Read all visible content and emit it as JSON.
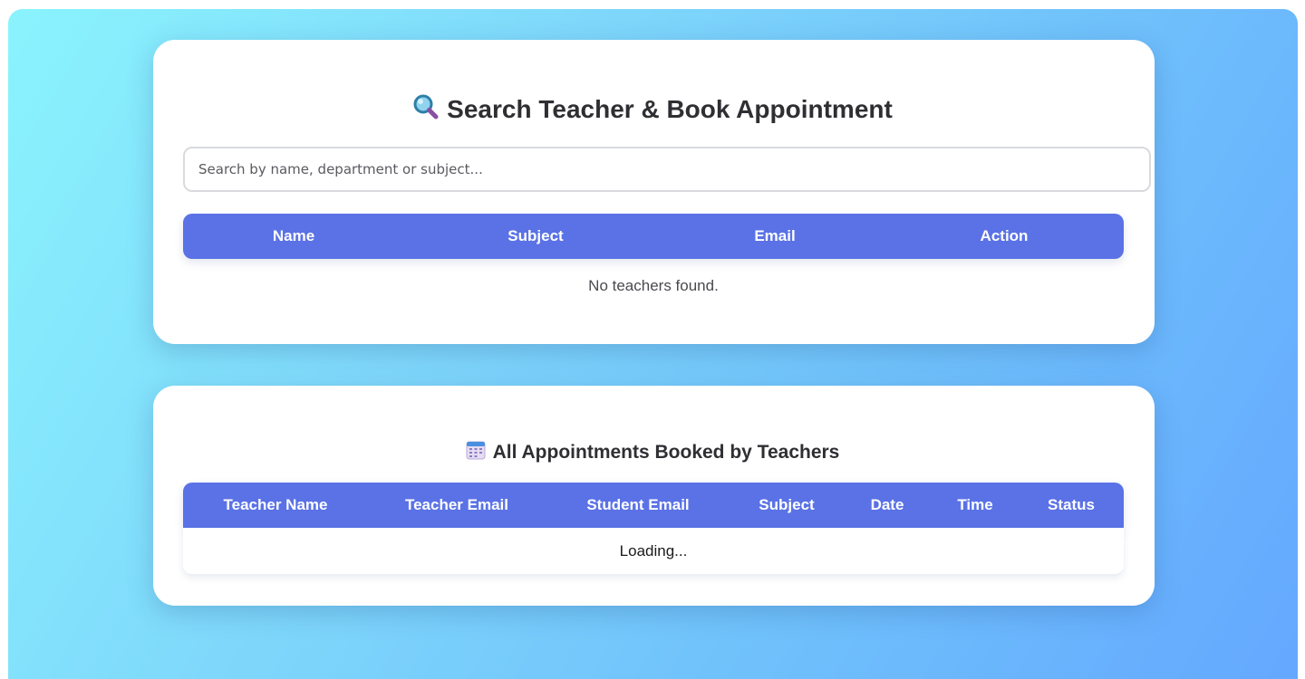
{
  "search_card": {
    "title": "Search Teacher & Book Appointment",
    "icon": "magnifier-icon",
    "search": {
      "placeholder": "Search by name, department or subject...",
      "value": ""
    },
    "table": {
      "columns": [
        "Name",
        "Subject",
        "Email",
        "Action"
      ],
      "rows": [],
      "empty_message": "No teachers found."
    }
  },
  "appointments_card": {
    "title": "All Appointments Booked by Teachers",
    "icon": "calendar-icon",
    "table": {
      "columns": [
        "Teacher Name",
        "Teacher Email",
        "Student Email",
        "Subject",
        "Date",
        "Time",
        "Status"
      ],
      "rows": [],
      "loading_message": "Loading..."
    }
  },
  "colors": {
    "table_header": "#5a72e6",
    "background_start": "#8af3fd",
    "background_end": "#64a8ff"
  }
}
